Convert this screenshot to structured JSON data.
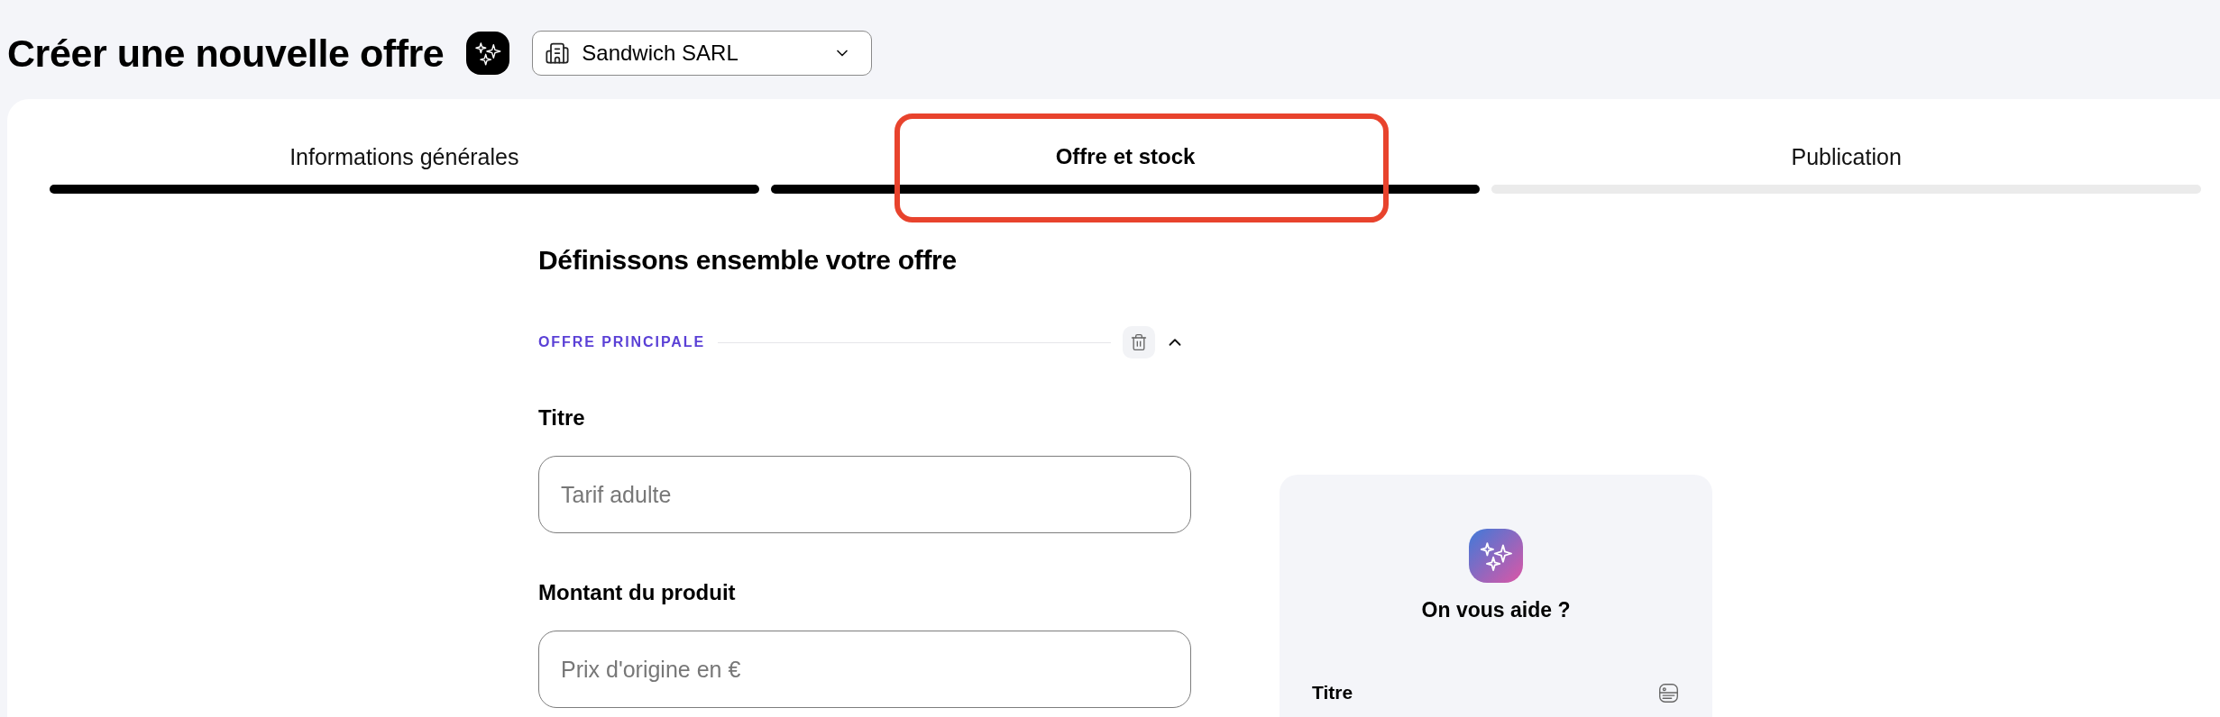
{
  "header": {
    "title": "Créer une nouvelle offre",
    "company_select": {
      "value": "Sandwich SARL"
    }
  },
  "tabs": [
    {
      "label": "Informations générales",
      "selected": false,
      "reached": true,
      "highlighted": false
    },
    {
      "label": "Offre et stock",
      "selected": true,
      "reached": true,
      "highlighted": true
    },
    {
      "label": "Publication",
      "selected": false,
      "reached": false,
      "highlighted": false
    }
  ],
  "form": {
    "heading": "Définissons ensemble votre offre",
    "section": {
      "title": "OFFRE PRINCIPALE",
      "expanded": true
    },
    "fields": [
      {
        "label": "Titre",
        "placeholder": "Tarif adulte"
      },
      {
        "label": "Montant du produit",
        "placeholder": "Prix d'origine en €"
      }
    ]
  },
  "help_panel": {
    "title": "On vous aide ?",
    "items": [
      {
        "label": "Titre"
      }
    ]
  }
}
